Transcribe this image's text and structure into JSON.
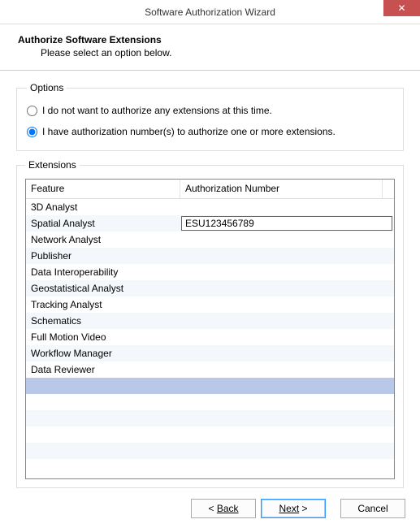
{
  "window": {
    "title": "Software Authorization Wizard",
    "close_glyph": "✕"
  },
  "header": {
    "title": "Authorize Software Extensions",
    "subtitle": "Please select an option below."
  },
  "options": {
    "legend": "Options",
    "radio_no_auth": "I do not want to authorize any extensions at this time.",
    "radio_have_auth": "I have authorization number(s) to authorize one or more extensions.",
    "selected": "have_auth"
  },
  "extensions": {
    "legend": "Extensions",
    "columns": {
      "feature": "Feature",
      "auth": "Authorization Number"
    },
    "rows": [
      {
        "feature": "3D Analyst",
        "auth": ""
      },
      {
        "feature": "Spatial Analyst",
        "auth": "ESU123456789",
        "editing": true
      },
      {
        "feature": "Network Analyst",
        "auth": ""
      },
      {
        "feature": "Publisher",
        "auth": ""
      },
      {
        "feature": "Data Interoperability",
        "auth": ""
      },
      {
        "feature": "Geostatistical Analyst",
        "auth": ""
      },
      {
        "feature": "Tracking Analyst",
        "auth": ""
      },
      {
        "feature": "Schematics",
        "auth": ""
      },
      {
        "feature": "Full Motion Video",
        "auth": ""
      },
      {
        "feature": "Workflow Manager",
        "auth": ""
      },
      {
        "feature": "Data Reviewer",
        "auth": ""
      }
    ],
    "selected_empty_row_index": 11,
    "total_visible_rows": 17
  },
  "buttons": {
    "back": "Back",
    "next": "Next",
    "cancel": "Cancel"
  }
}
